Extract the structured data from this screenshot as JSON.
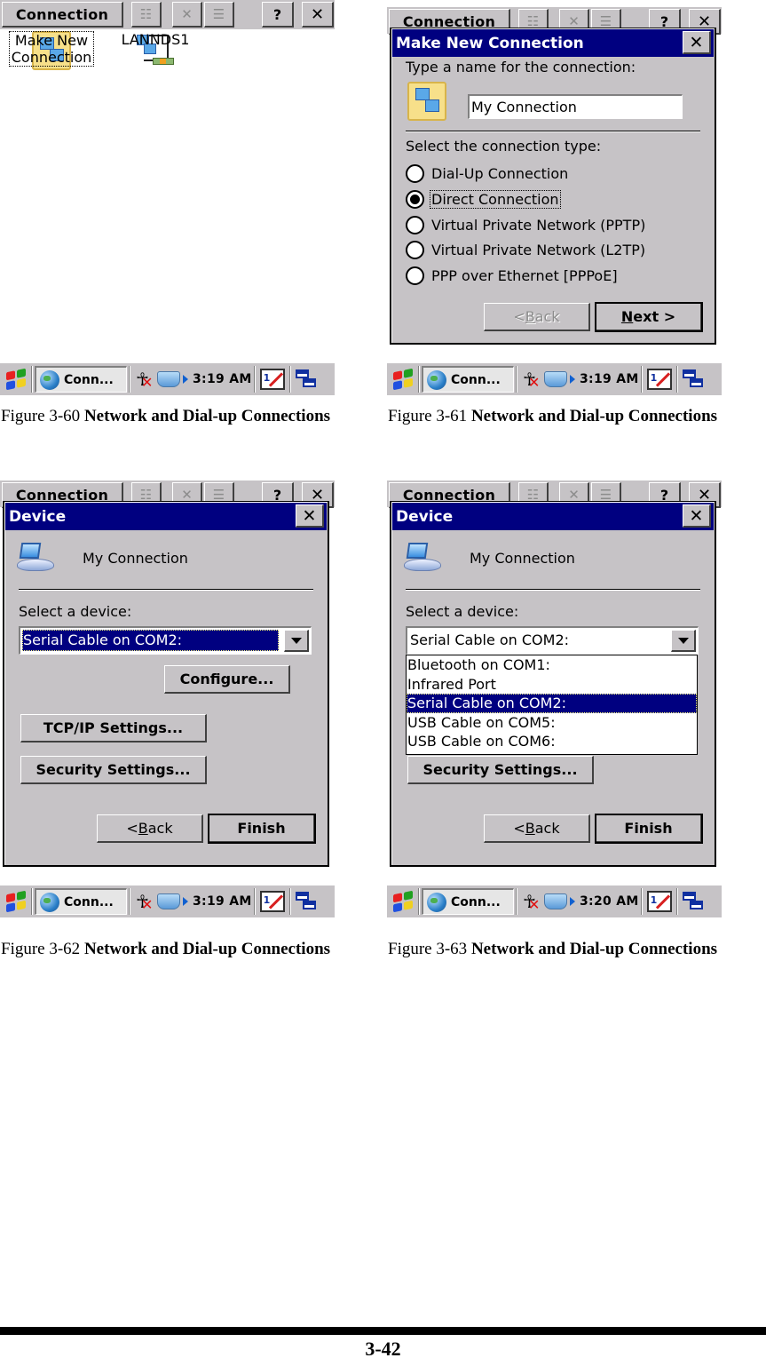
{
  "app": {
    "toolbar_title": "Connection",
    "help_label": "?",
    "close_label": "✕"
  },
  "taskbar_common": {
    "task_button_label": "Conn..."
  },
  "figures": [
    {
      "id": "3-60",
      "caption_prefix": "Figure 3-60",
      "caption_title": "Network and Dial-up Connections",
      "clock": "3:19 AM",
      "desktop_items": [
        {
          "label_line1": "Make New",
          "label_line2": "Connection",
          "icon": "make-new-connection-icon",
          "selected": true
        },
        {
          "label_line1": "LANNDS1",
          "label_line2": "",
          "icon": "lan-connection-icon",
          "selected": false
        }
      ]
    },
    {
      "id": "3-61",
      "caption_prefix": "Figure 3-61",
      "caption_title": "Network and Dial-up Connections",
      "clock": "3:19 AM",
      "dialog": {
        "title": "Make New Connection",
        "name_prompt": "Type a name for the connection:",
        "name_value": "My Connection",
        "type_prompt": "Select the connection type:",
        "types": [
          {
            "label": "Dial-Up Connection",
            "checked": false
          },
          {
            "label": "Direct Connection",
            "checked": true
          },
          {
            "label": "Virtual Private Network (PPTP)",
            "checked": false
          },
          {
            "label": "Virtual Private Network (L2TP)",
            "checked": false
          },
          {
            "label": "PPP over Ethernet [PPPoE]",
            "checked": false
          }
        ],
        "back_prefix": "< ",
        "back_mnemonic": "B",
        "back_rest": "ack",
        "back_enabled": false,
        "next_mnemonic": "N",
        "next_rest": "ext >"
      }
    },
    {
      "id": "3-62",
      "caption_prefix": "Figure 3-62",
      "caption_title": "Network and Dial-up Connections",
      "clock": "3:19 AM",
      "dialog": {
        "title": "Device",
        "connection_name": "My Connection",
        "device_prompt": "Select a device:",
        "device_value": "Serial Cable on COM2:",
        "configure_label": "Configure...",
        "tcpip_label": "TCP/IP Settings...",
        "security_label": "Security Settings...",
        "back_prefix": "< ",
        "back_mnemonic": "B",
        "back_rest": "ack",
        "finish_label": "Finish"
      }
    },
    {
      "id": "3-63",
      "caption_prefix": "Figure 3-63",
      "caption_title": "Network and Dial-up Connections",
      "clock": "3:20 AM",
      "dialog": {
        "title": "Device",
        "connection_name": "My Connection",
        "device_prompt": "Select a device:",
        "device_value": "Serial Cable on COM2:",
        "device_options": [
          "Bluetooth on COM1:",
          "Infrared Port",
          "Serial Cable on COM2:",
          "USB Cable on COM5:",
          "USB Cable on COM6:"
        ],
        "selected_option_index": 2,
        "security_label": "Security Settings...",
        "back_prefix": "< ",
        "back_mnemonic": "B",
        "back_rest": "ack",
        "finish_label": "Finish"
      }
    }
  ],
  "colors": {
    "title_bar": "#000080",
    "chrome_gray": "#c6c3c6",
    "selection": "#000080"
  },
  "page_number": "3-42"
}
